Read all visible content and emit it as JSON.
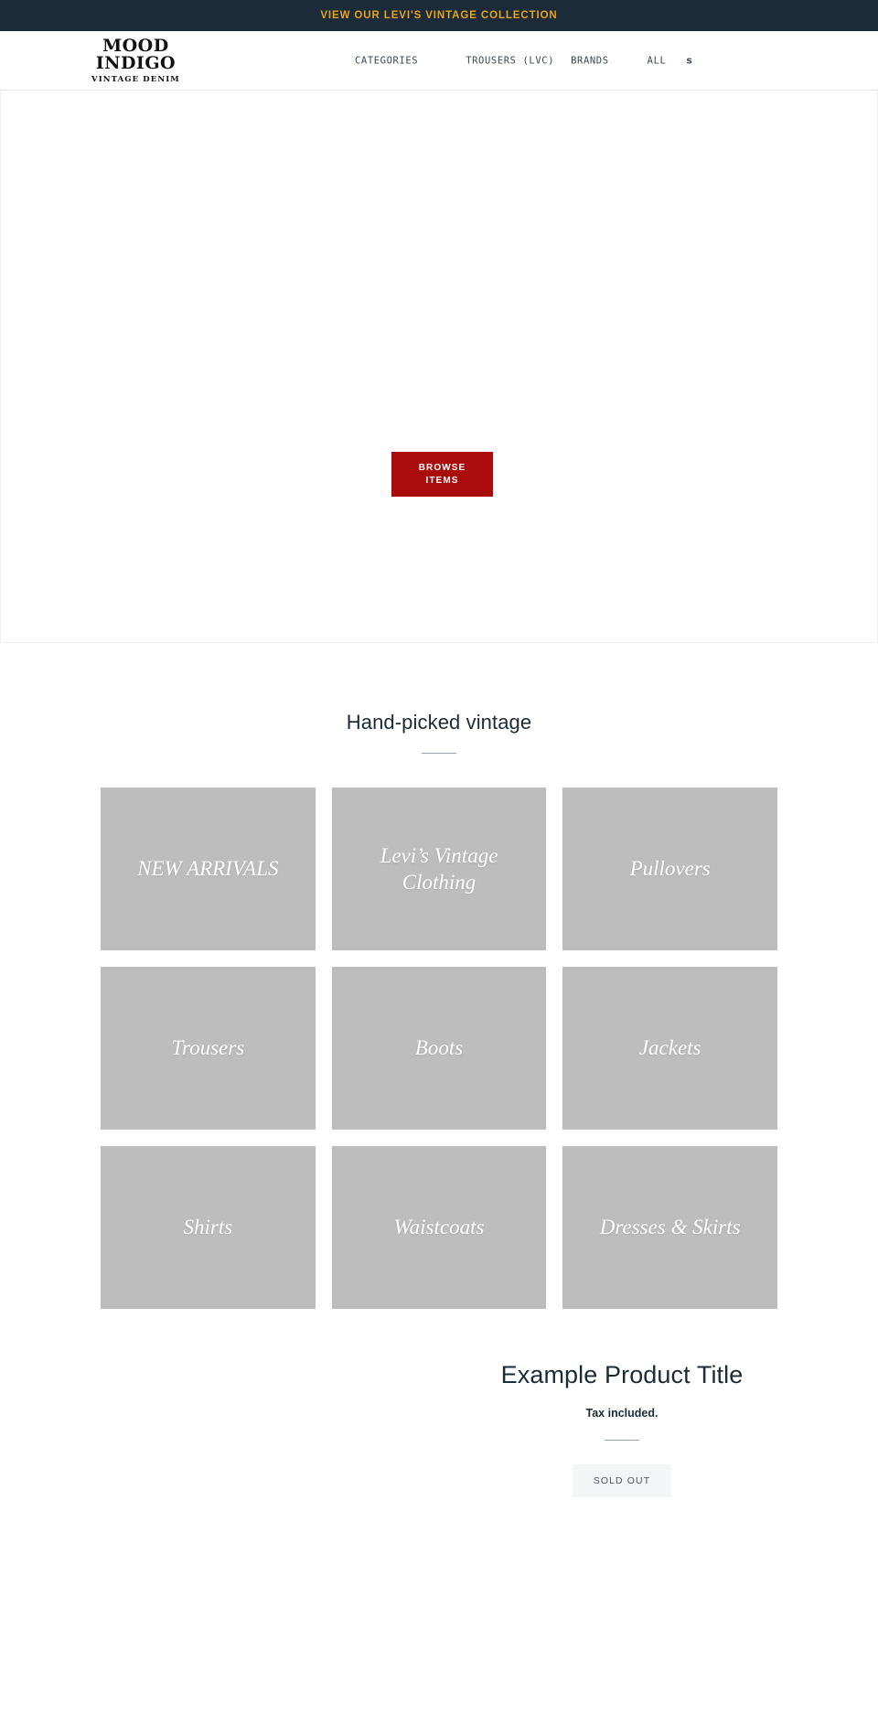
{
  "announcement": {
    "text": "VIEW OUR LEVI'S VINTAGE COLLECTION",
    "background": "#1c2b3a",
    "text_color": "#e8a317"
  },
  "header": {
    "logo": {
      "line1": "MOOD",
      "line2": "INDIGO",
      "subtitle": "VINTAGE DENIM"
    },
    "nav": [
      {
        "label": "CATEGORIES",
        "name": "categories"
      },
      {
        "label": "TROUSERS (LVC)",
        "name": "trousers-lvc"
      },
      {
        "label": "BRANDS",
        "name": "brands"
      },
      {
        "label": "ALL",
        "name": "all"
      }
    ],
    "search_icon": "s",
    "search_icon_name": "search-icon"
  },
  "hero": {
    "button_line1": "BROWSE",
    "button_line2": "ITEMS",
    "button_color": "#aa0c0c"
  },
  "collections": {
    "heading": "Hand-picked vintage",
    "tiles": [
      {
        "label": "NEW ARRIVALS"
      },
      {
        "label": "Levi’s Vintage Clothing"
      },
      {
        "label": "Pullovers"
      },
      {
        "label": "Trousers"
      },
      {
        "label": "Boots"
      },
      {
        "label": "Jackets"
      },
      {
        "label": "Shirts"
      },
      {
        "label": "Waistcoats"
      },
      {
        "label": "Dresses & Skirts"
      }
    ],
    "tile_placeholder_color": "#bdbdbd"
  },
  "featured_product": {
    "title": "Example Product Title",
    "tax_note": "Tax included.",
    "button_label": "SOLD OUT"
  }
}
